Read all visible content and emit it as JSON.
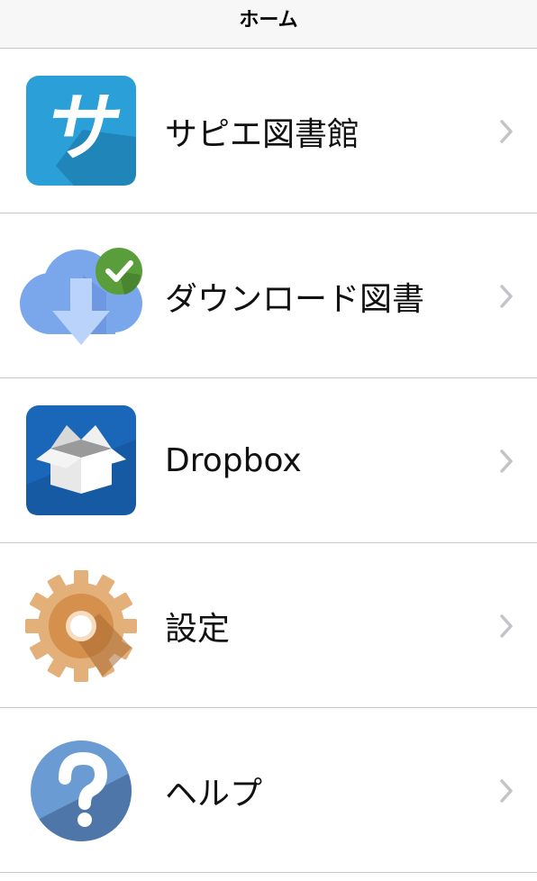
{
  "navbar": {
    "title": "ホーム"
  },
  "menu": {
    "items": [
      {
        "label": "サピエ図書館",
        "icon": "sapie-library-icon"
      },
      {
        "label": "ダウンロード図書",
        "icon": "cloud-download-icon"
      },
      {
        "label": "Dropbox",
        "icon": "dropbox-icon"
      },
      {
        "label": "設定",
        "icon": "gear-icon"
      },
      {
        "label": "ヘルプ",
        "icon": "help-question-icon"
      }
    ]
  },
  "sapie_logo_text": "サ",
  "colors": {
    "separator": "#c8c8c8",
    "chevron": "#c4c4c8",
    "sapie_blue": "#2a9fd8",
    "dropbox_blue": "#1a66b8",
    "gear_orange": "#e0a260",
    "help_blue": "#5f8fc4",
    "check_green": "#5a9e3c"
  }
}
